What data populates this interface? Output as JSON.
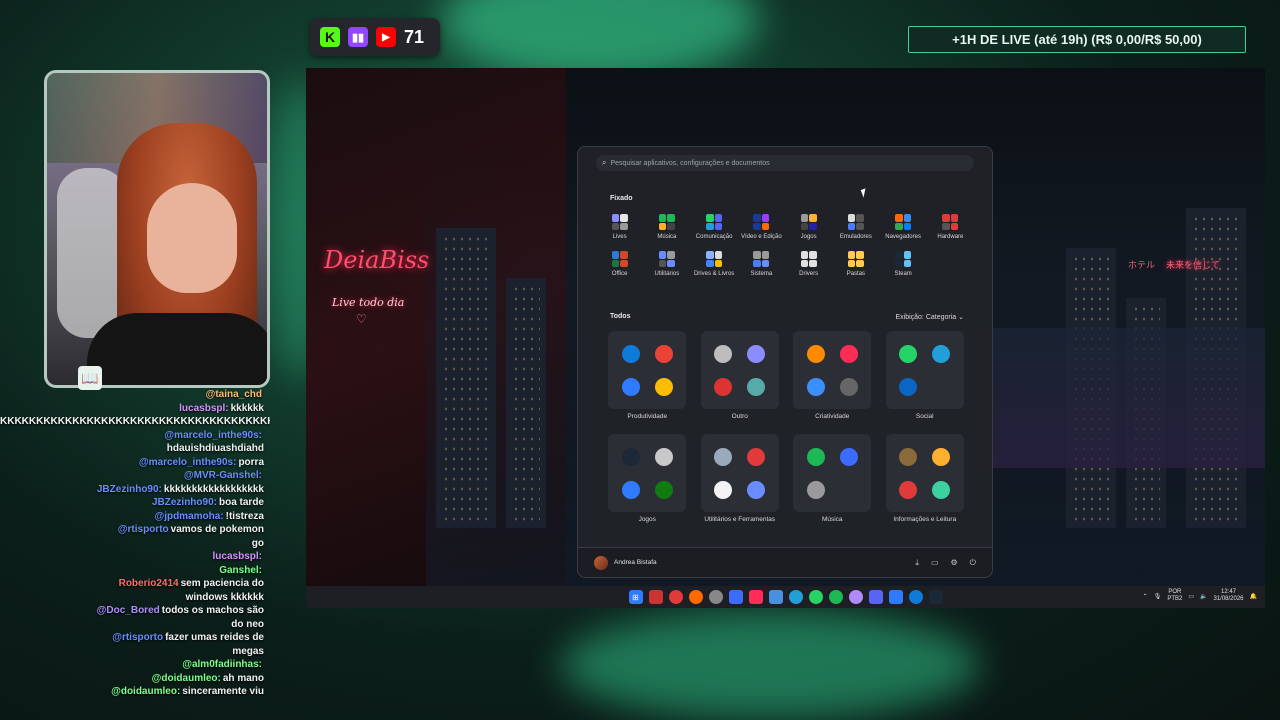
{
  "stream_badge": {
    "kick_icon": "kick-icon",
    "twitch_icon": "twitch-icon",
    "youtube_icon": "youtube-icon",
    "viewers": "71"
  },
  "live_goal": "+1H DE LIVE (até 19h) (R$ 0,00/R$ 50,00)",
  "chat": [
    {
      "user": "@taina_chd",
      "text": "",
      "color": "#ffb86b"
    },
    {
      "user": "lucasbspl:",
      "text": "kkkkkk",
      "color": "#d98fff"
    },
    {
      "user": "",
      "text": "KKKKKKKKKKKKKKKKKKKKKKKKKKKKKKKKKKKKKKKKK",
      "color": "#ffffff"
    },
    {
      "user": "@marcelo_inthe90s:",
      "text": "",
      "color": "#6a8cff"
    },
    {
      "user": "",
      "text": "hdauishdiuashdiahd",
      "color": "#ffffff"
    },
    {
      "user": "@marcelo_inthe90s:",
      "text": "porra",
      "color": "#6a8cff"
    },
    {
      "user": "@MVR-Ganshel:",
      "text": "",
      "color": "#6a8cff"
    },
    {
      "user": "JBZezinho90:",
      "text": "kkkkkkkkkkkkkkkkkk",
      "color": "#6a8cff"
    },
    {
      "user": "JBZezinho90:",
      "text": "boa tarde",
      "color": "#6a8cff"
    },
    {
      "user": "@jpdmamoha:",
      "text": "!tistreza",
      "color": "#6a8cff"
    },
    {
      "user": "@rtisporto",
      "text": "vamos de pokemon",
      "color": "#6a8cff"
    },
    {
      "user": "",
      "text": "go",
      "color": "#ffffff"
    },
    {
      "user": "lucasbspl:",
      "text": "",
      "color": "#d98fff"
    },
    {
      "user": "Ganshel:",
      "text": "",
      "color": "#7dff8a"
    },
    {
      "user": "Roberio2414",
      "text": "sem paciencia do",
      "color": "#ff6a6a"
    },
    {
      "user": "",
      "text": "windows kkkkkk",
      "color": "#ffffff"
    },
    {
      "user": "@Doc_Bored",
      "text": "todos os machos são",
      "color": "#b08bff"
    },
    {
      "user": "",
      "text": "do neo",
      "color": "#ffffff"
    },
    {
      "user": "@rtisporto",
      "text": "fazer umas reides de",
      "color": "#6a8cff"
    },
    {
      "user": "",
      "text": "megas",
      "color": "#ffffff"
    },
    {
      "user": "@alm0fadiinhas:",
      "text": "",
      "color": "#7dff8a"
    },
    {
      "user": "@doidaumleo:",
      "text": "ah mano",
      "color": "#7dff8a"
    },
    {
      "user": "@doidaumleo:",
      "text": "sinceramente viu",
      "color": "#7dff8a"
    }
  ],
  "desktop": {
    "neon_title": "DeiaBiss",
    "neon_subtitle": "Live todo dia",
    "neon_heart": "♡",
    "jp_sign_1": "ホテル",
    "jp_sign_2": "未来を信じて"
  },
  "start_menu": {
    "search_placeholder": "Pesquisar aplicativos, configurações e documentos",
    "pinned_title": "Fixado",
    "pinned": [
      {
        "label": "Lives",
        "c": [
          "#8a8cff",
          "#e6e6e6",
          "#555",
          "#9a9a9a"
        ]
      },
      {
        "label": "Música",
        "c": [
          "#1db954",
          "#1db954",
          "#ffb02e",
          "#444"
        ]
      },
      {
        "label": "Comunicação",
        "c": [
          "#25d366",
          "#5865f2",
          "#229ed9",
          "#5865f2"
        ]
      },
      {
        "label": "Vídeo e Edição",
        "c": [
          "#1a3b8f",
          "#9a3bff",
          "#1a3b8f",
          "#ff6a00"
        ]
      },
      {
        "label": "Jogos",
        "c": [
          "#9a9a9a",
          "#ffb02e",
          "#444",
          "#22a"
        ]
      },
      {
        "label": "Emuladores",
        "c": [
          "#dcdcdc",
          "#555",
          "#4a7cff",
          "#555"
        ]
      },
      {
        "label": "Navegadores",
        "c": [
          "#ff6a00",
          "#4285f4",
          "#34a853",
          "#0a7cff"
        ]
      },
      {
        "label": "Hardware",
        "c": [
          "#e03a3a",
          "#e03a3a",
          "#555",
          "#e03a3a"
        ]
      },
      {
        "label": "Office",
        "c": [
          "#2b7cd3",
          "#d24726",
          "#217346",
          "#d24726"
        ]
      },
      {
        "label": "Utilitários",
        "c": [
          "#6a8cff",
          "#9a9a9a",
          "#555",
          "#6a8cff"
        ]
      },
      {
        "label": "Drives & Livros",
        "c": [
          "#8fb2ff",
          "#dcdcdc",
          "#4285f4",
          "#fbbc05"
        ]
      },
      {
        "label": "Sistema",
        "c": [
          "#9a9a9a",
          "#9a9a9a",
          "#4a7cff",
          "#6a8cff"
        ]
      },
      {
        "label": "Drivers",
        "c": [
          "#e0e0e0",
          "#e0e0e0",
          "#e0e0e0",
          "#e0e0e0"
        ]
      },
      {
        "label": "Pastas",
        "c": [
          "#ffcc4d",
          "#ffcc4d",
          "#ffcc4d",
          "#ffcc4d"
        ]
      },
      {
        "label": "Steam",
        "c": [
          "#1b2838",
          "#66c0f4",
          "#1b2838",
          "#66c0f4"
        ]
      }
    ],
    "all_title": "Todos",
    "view_label": "Exibição: Categoria",
    "categories": [
      {
        "label": "Produtividade",
        "apps": [
          "#0f7bd8",
          "#ea4335",
          "#2f7bff",
          "#fbbc05"
        ]
      },
      {
        "label": "Outro",
        "apps": [
          "#bdbdbd",
          "#8a8cff",
          "#d33",
          "#5aa"
        ]
      },
      {
        "label": "Criatividade",
        "apps": [
          "#ff8a00",
          "#ff2d55",
          "#3b8fff",
          "#666"
        ]
      },
      {
        "label": "Social",
        "apps": [
          "#25d366",
          "#229ed9",
          "#0a66c2",
          "#2c2e35"
        ]
      },
      {
        "label": "Jogos",
        "apps": [
          "#1b2838",
          "#c8c8c8",
          "#2f7bff",
          "#107c10"
        ]
      },
      {
        "label": "Utilitários e Ferramentas",
        "apps": [
          "#9ab",
          "#e03a3a",
          "#f3f3f3",
          "#6a8cff"
        ]
      },
      {
        "label": "Música",
        "apps": [
          "#1db954",
          "#3b6bff",
          "#9a9a9a",
          "#2c2e35"
        ]
      },
      {
        "label": "Informações e Leitura",
        "apps": [
          "#8a6a3a",
          "#ffb02e",
          "#e03a3a",
          "#3bd1a0"
        ]
      }
    ],
    "user_name": "Andrea Bistafa",
    "footer_icons": [
      "download-icon",
      "folder-icon",
      "settings-icon",
      "power-icon"
    ]
  },
  "taskbar": {
    "lang_top": "POR",
    "lang_bottom": "PTB2",
    "time": "12:47",
    "date": "31/08/2026"
  }
}
